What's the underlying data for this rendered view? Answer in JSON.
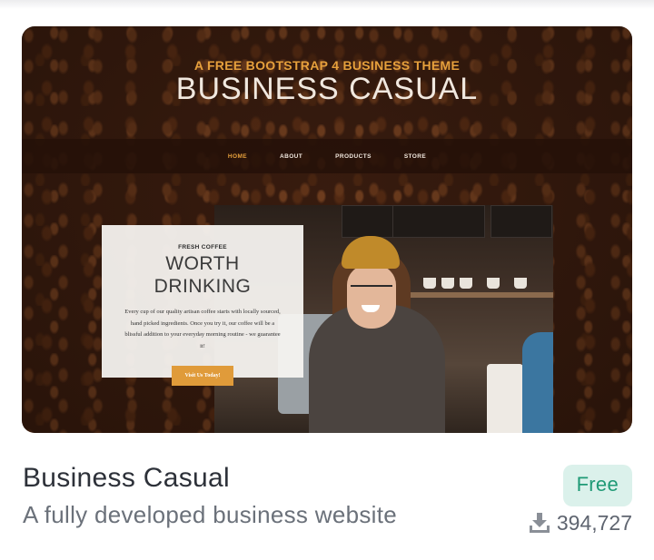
{
  "preview": {
    "subtitle": "A FREE BOOTSTRAP 4 BUSINESS THEME",
    "hero_title": "BUSINESS CASUAL",
    "nav": [
      "HOME",
      "ABOUT",
      "PRODUCTS",
      "STORE"
    ],
    "promo": {
      "kicker": "FRESH COFFEE",
      "heading_line1": "WORTH",
      "heading_line2": "DRINKING",
      "body": "Every cup of our quality artisan coffee starts with locally sourced, hand picked ingredients. Once you try it, our coffee will be a blissful addition to your everyday morning routine - we guarantee it!",
      "button": "Visit Us Today!"
    }
  },
  "card": {
    "title": "Business Casual",
    "description": "A fully developed business website",
    "price": "Free",
    "downloads": "394,727",
    "download_icon": "download-icon"
  },
  "colors": {
    "accent": "#e6a03c",
    "price_badge_bg": "#dbf1eb",
    "price_badge_text": "#1f9a76",
    "title_text": "#2d3139",
    "muted_text": "#6b717a"
  }
}
